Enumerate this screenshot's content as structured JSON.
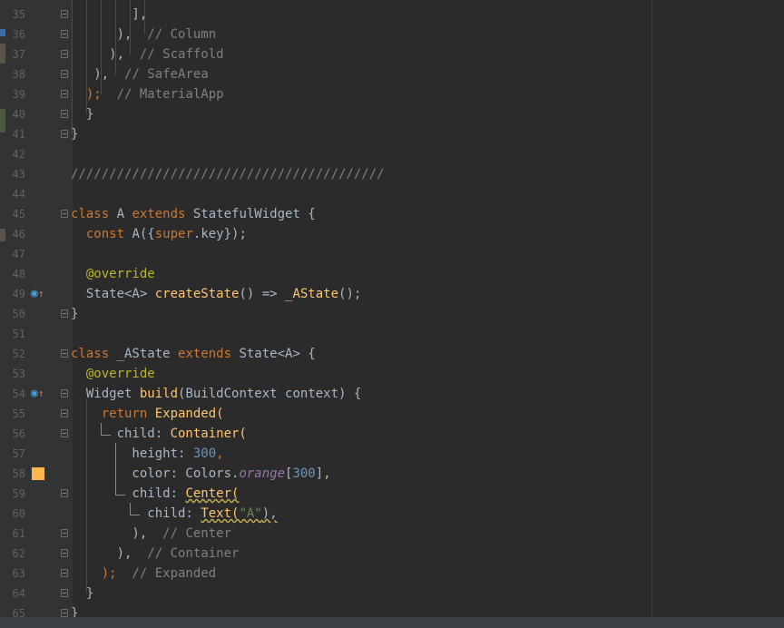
{
  "editor": {
    "language": "dart",
    "lines": [
      {
        "num": "35",
        "code": [
          {
            "t": "        ],",
            "c": "p"
          }
        ]
      },
      {
        "num": "36",
        "code": [
          {
            "t": "      ),",
            "c": "p"
          },
          {
            "t": "  // Column",
            "c": "c"
          }
        ]
      },
      {
        "num": "37",
        "code": [
          {
            "t": "     ),",
            "c": "p"
          },
          {
            "t": "  // Scaffold",
            "c": "c"
          }
        ]
      },
      {
        "num": "38",
        "code": [
          {
            "t": "   ),",
            "c": "p"
          },
          {
            "t": "  // SafeArea",
            "c": "c"
          }
        ]
      },
      {
        "num": "39",
        "code": [
          {
            "t": "  );",
            "c": "k"
          },
          {
            "t": "  // MaterialApp",
            "c": "c"
          }
        ]
      },
      {
        "num": "40",
        "code": [
          {
            "t": "  }",
            "c": "p"
          }
        ]
      },
      {
        "num": "41",
        "code": [
          {
            "t": "}",
            "c": "p"
          }
        ]
      },
      {
        "num": "42",
        "code": []
      },
      {
        "num": "43",
        "code": [
          {
            "t": "/////////////////////////////////////////",
            "c": "c"
          }
        ]
      },
      {
        "num": "44",
        "code": []
      },
      {
        "num": "45",
        "code": [
          {
            "t": "class ",
            "c": "k"
          },
          {
            "t": "A ",
            "c": "p"
          },
          {
            "t": "extends ",
            "c": "k"
          },
          {
            "t": "StatefulWidget {",
            "c": "p"
          }
        ]
      },
      {
        "num": "46",
        "code": [
          {
            "t": "  const ",
            "c": "k"
          },
          {
            "t": "A({",
            "c": "p"
          },
          {
            "t": "super",
            "c": "k"
          },
          {
            "t": ".key});",
            "c": "p"
          }
        ]
      },
      {
        "num": "47",
        "code": []
      },
      {
        "num": "48",
        "code": [
          {
            "t": "  @override",
            "c": "a"
          }
        ]
      },
      {
        "num": "49",
        "code": [
          {
            "t": "  State<A> ",
            "c": "p"
          },
          {
            "t": "createState",
            "c": "f"
          },
          {
            "t": "() => ",
            "c": "p"
          },
          {
            "t": "_AState",
            "c": "f"
          },
          {
            "t": "();",
            "c": "p"
          }
        ]
      },
      {
        "num": "50",
        "code": [
          {
            "t": "}",
            "c": "p"
          }
        ]
      },
      {
        "num": "51",
        "code": []
      },
      {
        "num": "52",
        "code": [
          {
            "t": "class ",
            "c": "k"
          },
          {
            "t": "_AState ",
            "c": "p"
          },
          {
            "t": "extends ",
            "c": "k"
          },
          {
            "t": "State<A> {",
            "c": "p"
          }
        ]
      },
      {
        "num": "53",
        "code": [
          {
            "t": "  @override",
            "c": "a"
          }
        ]
      },
      {
        "num": "54",
        "code": [
          {
            "t": "  Widget ",
            "c": "p"
          },
          {
            "t": "build",
            "c": "f"
          },
          {
            "t": "(BuildContext context) {",
            "c": "p"
          }
        ]
      },
      {
        "num": "55",
        "code": [
          {
            "t": "    return ",
            "c": "k"
          },
          {
            "t": "Expanded(",
            "c": "f"
          }
        ]
      },
      {
        "num": "56",
        "code": [
          {
            "t": "      child: ",
            "c": "p"
          },
          {
            "t": "Container(",
            "c": "f"
          }
        ]
      },
      {
        "num": "57",
        "code": [
          {
            "t": "        height: ",
            "c": "p"
          },
          {
            "t": "300",
            "c": "n"
          },
          {
            "t": ",",
            "c": "k"
          }
        ]
      },
      {
        "num": "58",
        "code": [
          {
            "t": "        color: Colors.",
            "c": "p"
          },
          {
            "t": "orange",
            "c": "sp"
          },
          {
            "t": "[",
            "c": "p"
          },
          {
            "t": "300",
            "c": "n"
          },
          {
            "t": "],",
            "c": "p"
          }
        ]
      },
      {
        "num": "59",
        "code": [
          {
            "t": "        child: ",
            "c": "p"
          },
          {
            "t": "Center(",
            "c": "f"
          }
        ]
      },
      {
        "num": "60",
        "code": [
          {
            "t": "          child: ",
            "c": "p"
          },
          {
            "t": "Text(",
            "c": "f"
          },
          {
            "t": "\"A\"",
            "c": "s"
          },
          {
            "t": "),",
            "c": "p"
          }
        ]
      },
      {
        "num": "61",
        "code": [
          {
            "t": "        ),",
            "c": "p"
          },
          {
            "t": "  // Center",
            "c": "c"
          }
        ]
      },
      {
        "num": "62",
        "code": [
          {
            "t": "      ),",
            "c": "p"
          },
          {
            "t": "  // Container",
            "c": "c"
          }
        ]
      },
      {
        "num": "63",
        "code": [
          {
            "t": "    );",
            "c": "k"
          },
          {
            "t": "  // Expanded",
            "c": "c"
          }
        ]
      },
      {
        "num": "64",
        "code": [
          {
            "t": "  }",
            "c": "p"
          }
        ]
      },
      {
        "num": "65",
        "code": [
          {
            "t": "}",
            "c": "p"
          }
        ]
      }
    ],
    "gutter_icons": {
      "49": "override-icon",
      "54": "override-icon"
    },
    "color_swatch_line": "58",
    "color_swatch_hex": "#ffb74d"
  },
  "colors": {
    "background": "#2b2b2b",
    "gutter": "#313335",
    "keyword": "#cc7832",
    "comment": "#808080",
    "number": "#6897bb",
    "string": "#6a8759",
    "annotation": "#bbb529",
    "function": "#ffc66d"
  }
}
